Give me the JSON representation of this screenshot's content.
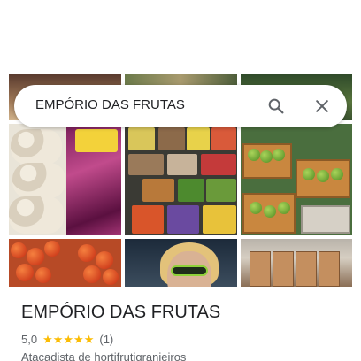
{
  "search": {
    "query": "EMPÓRIO DAS FRUTAS"
  },
  "place": {
    "name": "EMPÓRIO DAS FRUTAS",
    "rating": "5,0",
    "stars": 5,
    "reviews": "(1)",
    "category": "Atacadista de hortifrutigranjeiros"
  },
  "icons": {
    "search": "search-icon",
    "close": "close-icon",
    "star": "star-icon"
  },
  "colors": {
    "star": "#fbbc04",
    "icon": "#5f6368",
    "text": "#202124",
    "secondary_text": "#5f6368"
  }
}
